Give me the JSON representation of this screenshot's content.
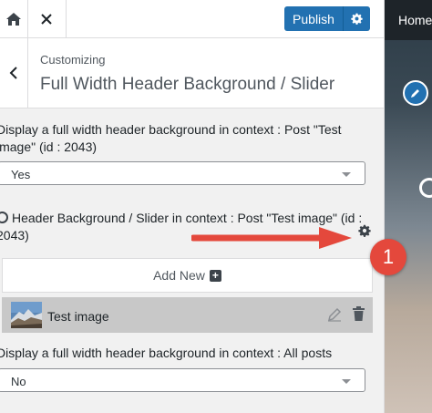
{
  "header": {
    "publish_label": "Publish"
  },
  "section": {
    "breadcrumb": "Customizing",
    "title": "Full Width Header Background / Slider"
  },
  "fields": {
    "post_display_label": "Display a full width header background in context : Post \"Test image\" (id : 2043)",
    "post_display_value": "Yes",
    "slider_label": "Header Background / Slider in context : Post \"Test image\" (id : 2043)",
    "add_new_label": "Add New",
    "slide_item_title": "Test image",
    "all_posts_label": "Display a full width header background in context : All posts",
    "all_posts_value": "No"
  },
  "preview": {
    "nav_home": "Home"
  },
  "annotation": {
    "badge_number": "1"
  },
  "colors": {
    "publish_blue": "#2271b1",
    "annotation_red": "#e4483c",
    "item_bg": "#c8c8c8"
  },
  "icons": [
    "home-icon",
    "close-icon",
    "gear-icon",
    "back-chevron-icon",
    "plus-square-icon",
    "pencil-icon",
    "trash-icon"
  ]
}
